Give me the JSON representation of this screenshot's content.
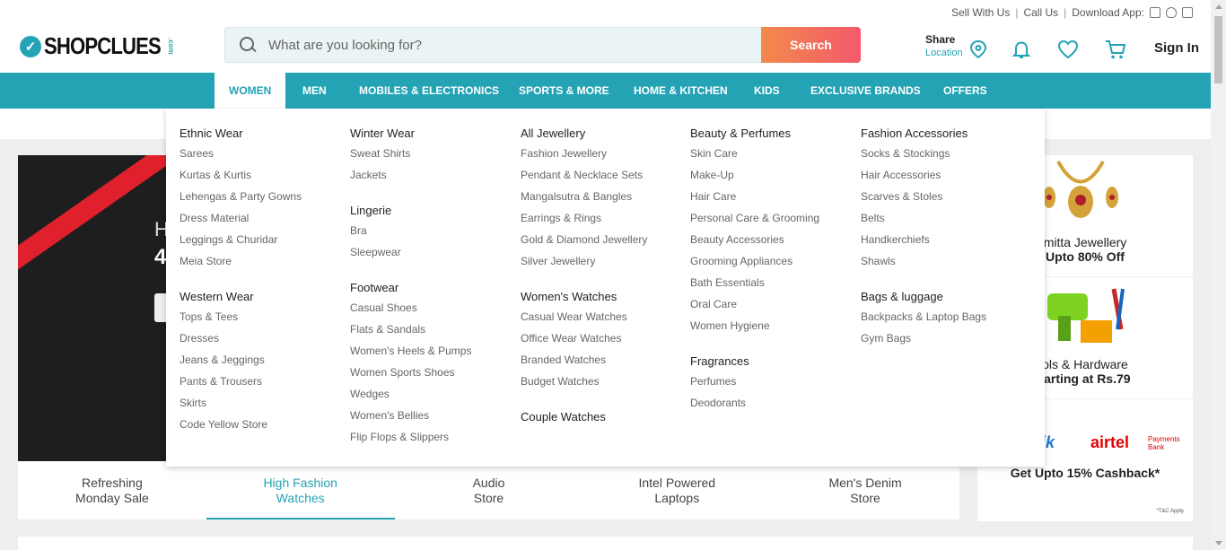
{
  "toplinks": {
    "sell": "Sell With Us",
    "call": "Call Us",
    "download": "Download App:"
  },
  "logo": {
    "text": "SHOPCLUES",
    "suffix": ".com",
    "mark": "✓"
  },
  "search": {
    "placeholder": "What are you looking for?",
    "button": "Search"
  },
  "share": {
    "label": "Share",
    "location": "Location"
  },
  "signin": "Sign In",
  "nav": [
    "WOMEN",
    "MEN",
    "MOBILES & ELECTRONICS",
    "SPORTS & MORE",
    "HOME & KITCHEN",
    "KIDS",
    "EXCLUSIVE BRANDS",
    "OFFERS"
  ],
  "mega": {
    "col1": [
      {
        "title": "Ethnic Wear",
        "items": [
          "Sarees",
          "Kurtas & Kurtis",
          "Lehengas & Party Gowns",
          "Dress Material",
          "Leggings & Churidar",
          "Meia Store"
        ]
      },
      {
        "title": "Western Wear",
        "items": [
          "Tops & Tees",
          "Dresses",
          "Jeans & Jeggings",
          "Pants & Trousers",
          "Skirts",
          "Code Yellow Store"
        ]
      }
    ],
    "col2": [
      {
        "title": "Winter Wear",
        "items": [
          "Sweat Shirts",
          "Jackets"
        ]
      },
      {
        "title": "Lingerie",
        "items": [
          "Bra",
          "Sleepwear"
        ]
      },
      {
        "title": "Footwear",
        "items": [
          "Casual Shoes",
          "Flats & Sandals",
          "Women's Heels & Pumps",
          "Women Sports Shoes",
          "Wedges",
          "Women's Bellies",
          "Flip Flops & Slippers"
        ]
      }
    ],
    "col3": [
      {
        "title": "All Jewellery",
        "items": [
          "Fashion Jewellery",
          "Pendant & Necklace Sets",
          "Mangalsutra & Bangles",
          "Earrings & Rings",
          "Gold & Diamond Jewellery",
          "Silver Jewellery"
        ]
      },
      {
        "title": "Women's Watches",
        "items": [
          "Casual Wear Watches",
          "Office Wear Watches",
          "Branded Watches",
          "Budget Watches"
        ]
      },
      {
        "title": "Couple Watches",
        "items": []
      }
    ],
    "col4": [
      {
        "title": "Beauty & Perfumes",
        "items": [
          "Skin Care",
          "Make-Up",
          "Hair Care",
          "Personal Care & Grooming",
          "Beauty Accessories",
          "Grooming Appliances",
          "Bath Essentials",
          "Oral Care",
          "Women Hygiene"
        ]
      },
      {
        "title": "Fragrances",
        "items": [
          "Perfumes",
          "Deodorants"
        ]
      }
    ],
    "col5": [
      {
        "title": "Fashion Accessories",
        "items": [
          "Socks & Stockings",
          "Hair Accessories",
          "Scarves & Stoles",
          "Belts",
          "Handkerchiefs",
          "Shawls"
        ]
      },
      {
        "title": "Bags & luggage",
        "items": [
          "Backpacks & Laptop Bags",
          "Gym Bags"
        ]
      }
    ]
  },
  "hero": {
    "line1": "H",
    "line2": "4"
  },
  "hero_tabs": [
    {
      "line1": "Refreshing",
      "line2": "Monday Sale"
    },
    {
      "line1": "High Fashion",
      "line2": "Watches"
    },
    {
      "line1": "Audio",
      "line2": "Store"
    },
    {
      "line1": "Intel Powered",
      "line2": "Laptops"
    },
    {
      "line1": "Men's Denim",
      "line2": "Store"
    }
  ],
  "side": [
    {
      "title": "mitta Jewellery",
      "sub": "Upto 80% Off"
    },
    {
      "title": "ols & Hardware",
      "sub": "tarting at Rs.79"
    },
    {
      "brand": "Kwik",
      "brand2": "airtel",
      "brand2_sub": "Payments Bank",
      "sub": "Get Upto 15% Cashback*",
      "note": "*T&C Apply"
    }
  ],
  "colors": {
    "accent": "#24a3b5",
    "search_btn": "#f4596c"
  }
}
